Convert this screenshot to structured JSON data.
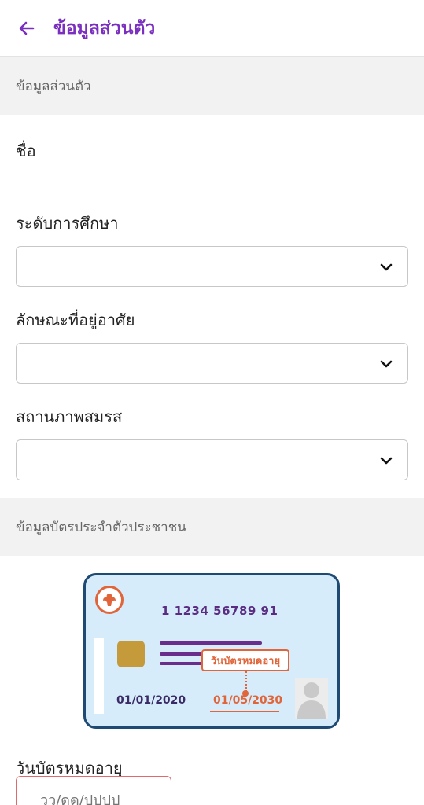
{
  "header": {
    "title": "ข้อมูลส่วนตัว"
  },
  "sections": {
    "personal": "ข้อมูลส่วนตัว",
    "id_card": "ข้อมูลบัตรประจำตัวประชาชน"
  },
  "fields": {
    "name_label": "ชื่อ",
    "education_label": "ระดับการศึกษา",
    "residence_label": "ลักษณะที่อยู่อาศัย",
    "marital_label": "สถานภาพสมรส",
    "expiry_label": "วันบัตรหมดอายุ",
    "expiry_placeholder": "วว/ดด/ปปปป"
  },
  "card": {
    "number": "1 1234 56789 91",
    "expiry_tag": "วันบัตรหมดอายุ",
    "issue_date": "01/01/2020",
    "expiry_date": "01/05/2030"
  },
  "colors": {
    "brand": "#7b2fbf",
    "card_bg": "#d6ecfa",
    "card_border": "#1f4a73",
    "accent": "#e0653a"
  },
  "icons": {
    "back": "arrow-left-icon",
    "chevron": "chevron-down-icon",
    "emblem": "garuda-emblem-icon",
    "photo": "person-silhouette-icon"
  }
}
